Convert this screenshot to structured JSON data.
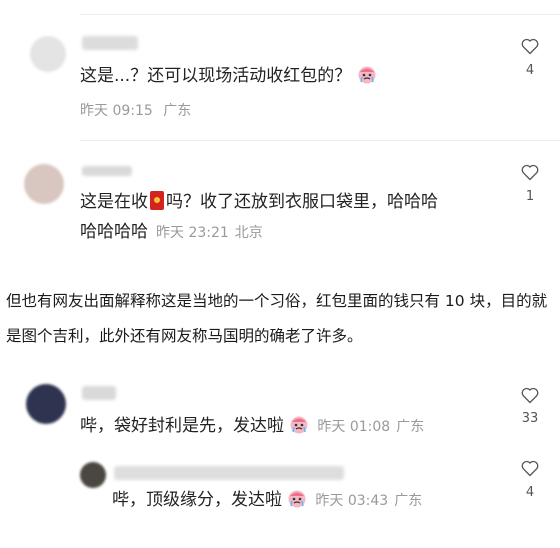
{
  "comments_top": [
    {
      "text": "这是...？还可以现场活动收红包的？",
      "time": "昨天 09:15",
      "location": "广东",
      "likes": "4"
    },
    {
      "text_part1": "这是在收",
      "text_part2": "吗？收了还放到衣服口袋里，哈哈哈",
      "text_line2": "哈哈哈哈",
      "time": "昨天 23:21",
      "location": "北京",
      "likes": "1"
    }
  ],
  "article": {
    "paragraph": "但也有网友出面解释称这是当地的一个习俗，红包里面的钱只有 10 块，目的就是图个吉利，此外还有网友称马国明的确老了许多。"
  },
  "comments_bottom": [
    {
      "text": "哔，袋好封利是先，发达啦",
      "time": "昨天 01:08",
      "location": "广东",
      "likes": "33"
    },
    {
      "text": "哔，顶级缘分，发达啦",
      "time": "昨天 03:43",
      "location": "广东",
      "likes": "4"
    }
  ],
  "icons": {
    "like": "heart-outline-icon",
    "emoji": "crying-face-emoji",
    "red_envelope": "red-envelope-emoji"
  },
  "colors": {
    "meta": "#9a9a9a",
    "envelope": "#d2231c"
  }
}
